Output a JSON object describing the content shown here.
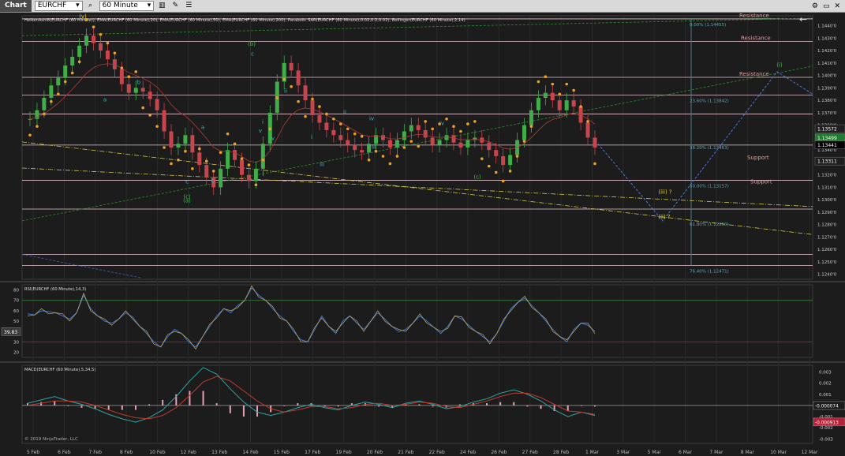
{
  "toolbar": {
    "title": "Chart",
    "instrument": "EURCHF",
    "interval": "60 Minute",
    "icons": [
      "search-icon",
      "dropdown-icon",
      "bar-style-icon",
      "draw-icon",
      "properties-icon",
      "window-icon"
    ]
  },
  "chart_data": [
    {
      "type": "candlestick",
      "panel": "price",
      "indicators_label": "HeikenAshi8(EURCHF (60 Minute)), EMA(EURCHF (60 Minute),20), EMA(EURCHF (60 Minute),50), EMA(EURCHF (60 Minute),200), Parabolic SAR(EURCHF (60 Minute),0.02,0.2,0.02), Bollinger(EURCHF (60 Minute),2,14)",
      "x_ticks": [
        "5 Feb",
        "6 Feb",
        "7 Feb",
        "8 Feb",
        "10 Feb",
        "12 Feb",
        "13 Feb",
        "14 Feb",
        "15 Feb",
        "17 Feb",
        "19 Feb",
        "20 Feb",
        "21 Feb",
        "22 Feb",
        "24 Feb",
        "26 Feb",
        "27 Feb",
        "28 Feb",
        "1 Mar",
        "3 Mar",
        "5 Mar",
        "6 Mar",
        "7 Mar",
        "8 Mar",
        "10 Mar",
        "12 Mar"
      ],
      "y_ticks": [
        "1.1440'0",
        "1.1430'0",
        "1.1420'0",
        "1.1410'0",
        "1.1400'0",
        "1.1390'0",
        "1.1380'0",
        "1.1370'0",
        "1.1360'0",
        "1.1350'0",
        "1.1340'0",
        "1.1330'0",
        "1.1320'0",
        "1.1310'0",
        "1.1300'0",
        "1.1290'0",
        "1.1280'0",
        "1.1270'0",
        "1.1260'0",
        "1.1250'0",
        "1.1240'0"
      ],
      "ylim": [
        1.1236,
        1.1448
      ],
      "price_flags": [
        {
          "label": "1.13572",
          "value": 1.13572,
          "color": "#1f1f1f"
        },
        {
          "label": "1.13499",
          "value": 1.13499,
          "color": "#1e7d2f"
        },
        {
          "label": "1.13441",
          "value": 1.13441,
          "color": "#000000"
        },
        {
          "label": "1.13311",
          "value": 1.13311,
          "color": "#1f1f1f"
        }
      ],
      "fib_levels": [
        {
          "label": "0.00% (1.14455)",
          "value": 1.14455
        },
        {
          "label": "23.60% (1.13842)",
          "value": 1.13842
        },
        {
          "label": "38.20% (1.13463)",
          "value": 1.13463
        },
        {
          "label": "50.00% (1.13157)",
          "value": 1.13157
        },
        {
          "label": "61.80% (1.12850)",
          "value": 1.1285
        },
        {
          "label": "76.40% (1.12471)",
          "value": 1.12471
        }
      ],
      "horizontal_levels": [
        1.14455,
        1.14273,
        1.13985,
        1.13842,
        1.1369,
        1.1344,
        1.13157,
        1.12925,
        1.1256,
        1.12471
      ],
      "annotations": {
        "resistance": "Resistance",
        "support": "Support",
        "waves": [
          "(v)",
          "a",
          "b",
          "c",
          "(a)",
          "(b)",
          "a",
          "b",
          "c",
          "ii",
          "i",
          "iv",
          "iii",
          "v",
          "(c)",
          "(i)",
          "(ii) ?",
          "(iii) ?",
          "ii",
          "i",
          "iv",
          "iii",
          "v",
          "(c)"
        ]
      },
      "close_values": [
        1.1365,
        1.1372,
        1.1382,
        1.1392,
        1.1398,
        1.1408,
        1.1415,
        1.1424,
        1.1432,
        1.1426,
        1.142,
        1.1413,
        1.1405,
        1.1393,
        1.1386,
        1.139,
        1.1387,
        1.1381,
        1.1372,
        1.1355,
        1.1342,
        1.1345,
        1.1352,
        1.1338,
        1.1328,
        1.1318,
        1.131,
        1.1325,
        1.134,
        1.1332,
        1.132,
        1.1315,
        1.1325,
        1.1345,
        1.137,
        1.1395,
        1.141,
        1.1404,
        1.1392,
        1.138,
        1.1368,
        1.1362,
        1.1356,
        1.1352,
        1.1348,
        1.1344,
        1.134,
        1.1338,
        1.1345,
        1.1352,
        1.1348,
        1.1342,
        1.1348,
        1.1355,
        1.136,
        1.1356,
        1.135,
        1.1344,
        1.1348,
        1.1352,
        1.1346,
        1.1342,
        1.1348,
        1.135,
        1.1346,
        1.134,
        1.1335,
        1.1328,
        1.1336,
        1.1348,
        1.136,
        1.1372,
        1.1382,
        1.1386,
        1.138,
        1.1372,
        1.138,
        1.1375,
        1.1362,
        1.135,
        1.1342
      ]
    },
    {
      "type": "line",
      "panel": "rsi",
      "label": "RSI(EURCHF (60 Minute),14,3)",
      "y_ticks": [
        "80",
        "70",
        "60",
        "50",
        "40",
        "30",
        "20"
      ],
      "ylim": [
        15,
        85
      ],
      "levels": [
        70,
        30
      ],
      "current_label": "39.83",
      "values": [
        57,
        56,
        60,
        59,
        58,
        55,
        52,
        58,
        75,
        62,
        55,
        50,
        48,
        52,
        58,
        54,
        45,
        38,
        30,
        25,
        35,
        42,
        38,
        30,
        25,
        35,
        45,
        55,
        62,
        58,
        65,
        70,
        82,
        75,
        70,
        62,
        55,
        50,
        40,
        32,
        30,
        42,
        55,
        45,
        38,
        50,
        55,
        48,
        42,
        50,
        58,
        52,
        45,
        40,
        42,
        48,
        55,
        50,
        44,
        38,
        45,
        55,
        52,
        46,
        40,
        35,
        30,
        38,
        50,
        62,
        68,
        72,
        65,
        58,
        50,
        42,
        35,
        30,
        42,
        48,
        46,
        40
      ]
    },
    {
      "type": "line",
      "panel": "macd",
      "label": "MACD(EURCHF (60 Minute),5,34,5)",
      "y_ticks": [
        "0.003",
        "0.002",
        "0.001",
        "0",
        "-0.001",
        "-0.002",
        "-0.003"
      ],
      "ylim": [
        -0.0034,
        0.0036
      ],
      "flags": [
        {
          "label": "-0.000074",
          "value": -7.4e-05,
          "color": "#1a1a1a"
        },
        {
          "label": "-0.000913",
          "value": -0.000913,
          "color": "#b3243a"
        }
      ],
      "copyright": "© 2019 NinjaTrader, LLC",
      "series": [
        {
          "name": "MACD",
          "color": "#2ca5a5",
          "values": [
            0.0002,
            0.0005,
            0.0008,
            0.0004,
            0.0001,
            -0.0003,
            -0.0008,
            -0.0012,
            -0.0015,
            -0.0011,
            -0.0004,
            0.0008,
            0.0022,
            0.0034,
            0.0028,
            0.0015,
            0.0003,
            -0.0006,
            -0.0009,
            -0.0006,
            -0.0002,
            0.0001,
            -0.0002,
            -0.0004,
            0.0,
            0.0003,
            0.0001,
            -0.0002,
            0.0002,
            0.0004,
            0.0001,
            -0.0003,
            -0.0001,
            0.0003,
            0.0006,
            0.0011,
            0.0014,
            0.001,
            0.0004,
            -0.0004,
            -0.001,
            -0.0006,
            -0.0009
          ]
        },
        {
          "name": "Signal",
          "color": "#c0392b",
          "values": [
            0.0,
            0.0002,
            0.0004,
            0.0004,
            0.0003,
            0.0,
            -0.0004,
            -0.0008,
            -0.0011,
            -0.0012,
            -0.0009,
            -0.0002,
            0.0009,
            0.0021,
            0.0026,
            0.0022,
            0.0013,
            0.0004,
            -0.0003,
            -0.0006,
            -0.0004,
            -0.0001,
            -0.0001,
            -0.0003,
            -0.0002,
            0.0001,
            0.0002,
            0.0,
            0.0001,
            0.0003,
            0.0002,
            -0.0001,
            -0.0002,
            0.0001,
            0.0004,
            0.0008,
            0.0011,
            0.0011,
            0.0007,
            0.0001,
            -0.0005,
            -0.0006,
            -0.0008
          ]
        }
      ]
    }
  ]
}
